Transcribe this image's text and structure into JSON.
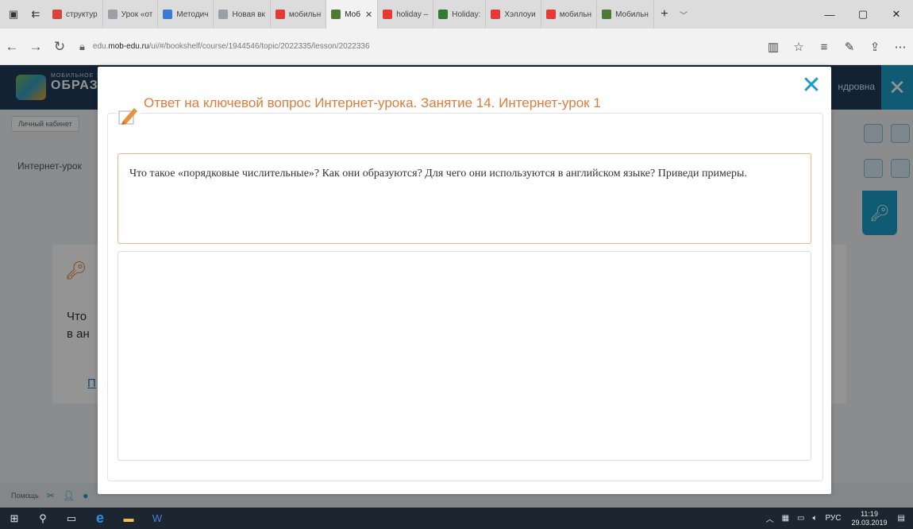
{
  "browser": {
    "tabs": [
      {
        "label": "структур",
        "color": "#d9443a"
      },
      {
        "label": "Урок «от",
        "color": "#9aa0a6"
      },
      {
        "label": "Методич",
        "color": "#3a7bd5"
      },
      {
        "label": "Новая вк",
        "color": "#9aa0a6"
      },
      {
        "label": "мобильн",
        "color": "#e53935"
      },
      {
        "label": "Моб",
        "color": "#4c7a34",
        "active": true
      },
      {
        "label": "holiday –",
        "color": "#e53935"
      },
      {
        "label": "Holiday: ",
        "color": "#2e7d32"
      },
      {
        "label": "Хэллоуи",
        "color": "#e53935"
      },
      {
        "label": "мобильн",
        "color": "#e53935"
      },
      {
        "label": "Мобильн",
        "color": "#4c7a34"
      }
    ],
    "url_prefix": "edu.",
    "url_host": "mob-edu.ru",
    "url_path": "/ui/#/bookshelf/course/1944546/topic/2022335/lesson/2022336"
  },
  "site": {
    "logo_small": "МОБИЛЬНОЕ Э",
    "logo_big": "ОБРАЗО",
    "user_name": "ндровна",
    "crumb": "Личный кабинет",
    "lesson_label": "Интернет-урок",
    "bg_question_1": "Что",
    "bg_question_2": "в ан",
    "bg_link": "П",
    "help_label": "Помощь"
  },
  "modal": {
    "title": "Ответ на ключевой вопрос Интернет-урока. Занятие 14. Интернет-урок 1",
    "question": "Что такое «порядковые числительные»? Как они образуются? Для чего они используются в английском языке? Приведи примеры.",
    "answer_value": "",
    "close_symbol": "✕"
  },
  "taskbar": {
    "language": "РУС",
    "time": "11:19",
    "date": "29.03.2019"
  },
  "colors": {
    "accent_blue": "#1a9dc8",
    "title_orange": "#e27b3a",
    "question_border": "#f0b38d",
    "header_navy": "#1f3b57"
  }
}
